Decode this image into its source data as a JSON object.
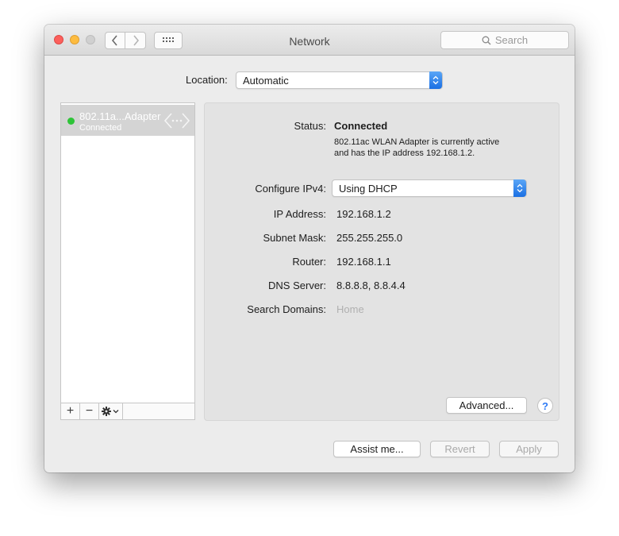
{
  "window": {
    "title": "Network"
  },
  "toolbar": {
    "back_icon": "chevron-left-icon",
    "forward_icon": "chevron-right-icon",
    "grid_icon": "grid-icon",
    "search_placeholder": "Search"
  },
  "location": {
    "label": "Location:",
    "value": "Automatic"
  },
  "sidebar": {
    "services": [
      {
        "name": "802.11a...Adapter",
        "state": "Connected",
        "status_color": "#2ec438"
      }
    ],
    "toolbar": {
      "add": "+",
      "remove": "−"
    }
  },
  "detail": {
    "status_label": "Status:",
    "status_value": "Connected",
    "status_desc_line1": "802.11ac WLAN Adapter  is currently active",
    "status_desc_line2": "and has the IP address 192.168.1.2.",
    "configure_label": "Configure IPv4:",
    "configure_value": "Using DHCP",
    "ip_label": "IP Address:",
    "ip_value": "192.168.1.2",
    "subnet_label": "Subnet Mask:",
    "subnet_value": "255.255.255.0",
    "router_label": "Router:",
    "router_value": "192.168.1.1",
    "dns_label": "DNS Server:",
    "dns_value": "8.8.8.8, 8.8.4.4",
    "search_domains_label": "Search Domains:",
    "search_domains_placeholder": "Home",
    "advanced_button": "Advanced...",
    "help_button": "?"
  },
  "footer": {
    "assist_button": "Assist me...",
    "revert_button": "Revert",
    "apply_button": "Apply"
  }
}
